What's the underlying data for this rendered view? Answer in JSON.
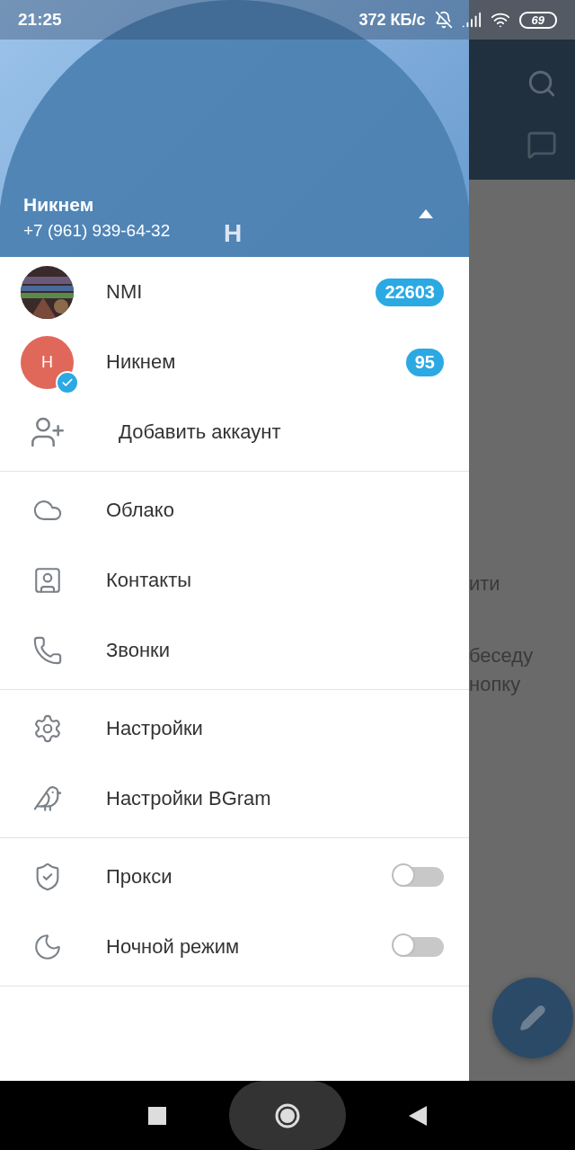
{
  "status_bar": {
    "time": "21:25",
    "speed": "372 КБ/с",
    "battery": "69"
  },
  "header": {
    "name": "Никнем",
    "phone": "+7 (961) 939-64-32",
    "avatar_letter": "Н",
    "expanded": true
  },
  "accounts": [
    {
      "name": "NMI",
      "badge": "22603",
      "selected": false
    },
    {
      "name": "Никнем",
      "badge": "95",
      "avatar": {
        "kind": "letter",
        "letter": "Н",
        "color": "#e0685a"
      },
      "selected": true
    }
  ],
  "add_account": {
    "label": "Добавить аккаунт"
  },
  "menu_sections": [
    [
      {
        "label": "Облако",
        "kind": "link"
      },
      {
        "label": "Контакты",
        "kind": "link"
      },
      {
        "label": "Звонки",
        "kind": "link"
      }
    ],
    [
      {
        "label": "Настройки",
        "kind": "link"
      },
      {
        "label": "Настройки BGram",
        "kind": "link"
      }
    ],
    [
      {
        "label": "Прокси",
        "kind": "toggle",
        "on": false
      },
      {
        "label": "Ночной режим",
        "kind": "toggle",
        "on": false
      }
    ]
  ],
  "background_texts": [
    "ити",
    "беседу",
    "нопку"
  ]
}
